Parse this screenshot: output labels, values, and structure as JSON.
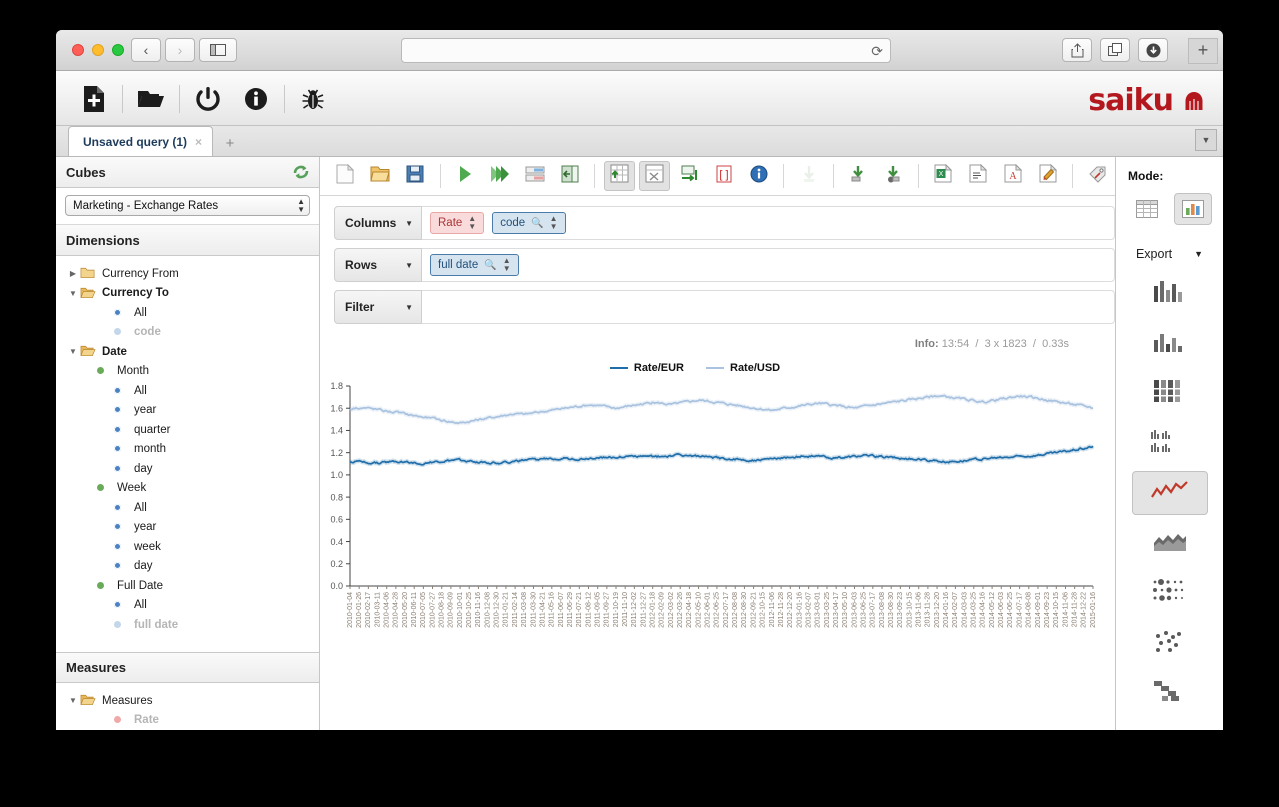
{
  "browser": {
    "url_value": "",
    "url_placeholder": "",
    "back_label": "‹",
    "forward_label": "›",
    "reload_label": "⟳",
    "new_tab_label": "+"
  },
  "app": {
    "logo_text": "saiku",
    "toolbar_icons": [
      "new-document",
      "open-folder",
      "power",
      "info",
      "bug"
    ]
  },
  "tabs": {
    "items": [
      {
        "label": "Unsaved query (1)",
        "close": "×"
      }
    ],
    "add_label": "+",
    "overflow_label": "▼"
  },
  "sidebar": {
    "cubes_title": "Cubes",
    "cube_selected": "Marketing - Exchange Rates",
    "dimensions_title": "Dimensions",
    "measures_title": "Measures",
    "tree": [
      {
        "label": "Currency From",
        "type": "folder",
        "arrow": "▶",
        "indent": 0,
        "style": "plain"
      },
      {
        "label": "Currency To",
        "type": "folder-open",
        "arrow": "▼",
        "indent": 0,
        "style": "bold"
      },
      {
        "label": "All",
        "type": "level-blue",
        "indent": 2,
        "style": "plain"
      },
      {
        "label": "code",
        "type": "level-pale",
        "indent": 2,
        "style": "grey"
      },
      {
        "label": "Date",
        "type": "folder-open",
        "arrow": "▼",
        "indent": 0,
        "style": "bold"
      },
      {
        "label": "Month",
        "type": "hier-green",
        "indent": 1,
        "style": "plain"
      },
      {
        "label": "All",
        "type": "level-blue",
        "indent": 2,
        "style": "plain"
      },
      {
        "label": "year",
        "type": "level-blue",
        "indent": 2,
        "style": "plain"
      },
      {
        "label": "quarter",
        "type": "level-blue",
        "indent": 2,
        "style": "plain"
      },
      {
        "label": "month",
        "type": "level-blue",
        "indent": 2,
        "style": "plain"
      },
      {
        "label": "day",
        "type": "level-blue",
        "indent": 2,
        "style": "plain"
      },
      {
        "label": "Week",
        "type": "hier-green",
        "indent": 1,
        "style": "plain"
      },
      {
        "label": "All",
        "type": "level-blue",
        "indent": 2,
        "style": "plain"
      },
      {
        "label": "year",
        "type": "level-blue",
        "indent": 2,
        "style": "plain"
      },
      {
        "label": "week",
        "type": "level-blue",
        "indent": 2,
        "style": "plain"
      },
      {
        "label": "day",
        "type": "level-blue",
        "indent": 2,
        "style": "plain"
      },
      {
        "label": "Full Date",
        "type": "hier-green",
        "indent": 1,
        "style": "plain"
      },
      {
        "label": "All",
        "type": "level-blue",
        "indent": 2,
        "style": "plain"
      },
      {
        "label": "full date",
        "type": "level-pale",
        "indent": 2,
        "style": "grey"
      }
    ],
    "measures_tree": [
      {
        "label": "Measures",
        "type": "folder-open",
        "arrow": "▼",
        "indent": 0,
        "style": "plain"
      },
      {
        "label": "Rate",
        "type": "measure-pink",
        "indent": 2,
        "style": "grey"
      }
    ]
  },
  "dropzones": {
    "columns": {
      "label": "Columns",
      "chips": [
        {
          "text": "Rate",
          "kind": "measure",
          "has_search": false
        },
        {
          "text": "code",
          "kind": "dim",
          "has_search": true
        }
      ]
    },
    "rows": {
      "label": "Rows",
      "chips": [
        {
          "text": "full date",
          "kind": "dim",
          "has_search": true
        }
      ]
    },
    "filter": {
      "label": "Filter",
      "chips": []
    }
  },
  "info": {
    "prefix": "Info:",
    "time": "13:54",
    "size": "3 x 1823",
    "duration": "0.33s",
    "separator": "/"
  },
  "mode_panel": {
    "title": "Mode:",
    "table_mode_label": "table-mode",
    "chart_mode_label": "chart-mode",
    "export_label": "Export",
    "export_caret": "▼",
    "chart_types": [
      "bar-chart",
      "stacked-bar-chart",
      "stacked-percent-bar-chart",
      "multiple-bar-chart",
      "line-chart",
      "area-chart",
      "dot-matrix-chart",
      "scatter-chart",
      "waterfall-chart",
      "pie-chart"
    ],
    "selected_chart_type": "line-chart"
  },
  "chart_data": {
    "type": "line",
    "title": "",
    "xlabel": "",
    "ylabel": "",
    "ylim": [
      0.0,
      1.8
    ],
    "yticks": [
      0.0,
      0.2,
      0.4,
      0.6,
      0.8,
      1.0,
      1.2,
      1.4,
      1.6,
      1.8
    ],
    "grid": false,
    "legend_position": "top-center",
    "colors": {
      "Rate/EUR": "#1f6eaa",
      "Rate/USD": "#a8c2df"
    },
    "xtick_start": "2010-01-04",
    "xtick_end": "2015-01-17",
    "xtick_step_days": 22,
    "xticks": [
      "2010-01-04",
      "2010-01-26",
      "2010-02-17",
      "2010-03-11",
      "2010-04-06",
      "2010-04-28",
      "2010-05-20",
      "2010-06-11",
      "2010-07-05",
      "2010-07-27",
      "2010-08-18",
      "2010-09-09",
      "2010-10-01",
      "2010-10-25",
      "2010-11-16",
      "2010-12-08",
      "2010-12-30",
      "2011-01-21",
      "2011-02-14",
      "2011-03-08",
      "2011-03-30",
      "2011-04-21",
      "2011-05-16",
      "2011-06-07",
      "2011-06-29",
      "2011-07-21",
      "2011-08-12",
      "2011-09-05",
      "2011-09-27",
      "2011-10-19",
      "2011-11-10",
      "2011-12-02",
      "2011-12-27",
      "2012-01-18",
      "2012-02-09",
      "2012-03-02",
      "2012-03-26",
      "2012-04-18",
      "2012-05-10",
      "2012-06-01",
      "2012-06-25",
      "2012-07-17",
      "2012-08-08",
      "2012-08-30",
      "2012-09-21",
      "2012-10-15",
      "2012-11-06",
      "2012-11-28",
      "2012-12-20",
      "2013-01-16",
      "2013-02-07",
      "2013-03-01",
      "2013-03-25",
      "2013-04-17",
      "2013-05-10",
      "2013-06-03",
      "2013-06-25",
      "2013-07-17",
      "2013-08-08",
      "2013-08-30",
      "2013-09-23",
      "2013-10-15",
      "2013-11-06",
      "2013-11-28",
      "2013-12-20",
      "2014-01-16",
      "2014-02-07",
      "2014-03-03",
      "2014-03-25",
      "2014-04-16",
      "2014-05-12",
      "2014-06-03",
      "2014-06-25",
      "2014-07-17",
      "2014-08-08",
      "2014-09-01",
      "2014-09-23",
      "2014-10-15",
      "2014-11-06",
      "2014-11-28",
      "2014-12-22",
      "2015-01-16"
    ],
    "series": [
      {
        "name": "Rate/EUR",
        "color": "#1f6eaa",
        "values": [
          1.117,
          1.12,
          1.112,
          1.108,
          1.115,
          1.122,
          1.118,
          1.11,
          1.105,
          1.112,
          1.12,
          1.126,
          1.13,
          1.124,
          1.118,
          1.112,
          1.108,
          1.114,
          1.122,
          1.128,
          1.135,
          1.142,
          1.148,
          1.152,
          1.147,
          1.14,
          1.148,
          1.156,
          1.16,
          1.158,
          1.164,
          1.17,
          1.166,
          1.16,
          1.168,
          1.174,
          1.178,
          1.172,
          1.166,
          1.158,
          1.152,
          1.146,
          1.14,
          1.134,
          1.128,
          1.134,
          1.142,
          1.15,
          1.158,
          1.164,
          1.17,
          1.166,
          1.158,
          1.152,
          1.16,
          1.168,
          1.174,
          1.17,
          1.164,
          1.158,
          1.15,
          1.144,
          1.138,
          1.132,
          1.126,
          1.12,
          1.124,
          1.13,
          1.136,
          1.142,
          1.148,
          1.154,
          1.16,
          1.166,
          1.172,
          1.18,
          1.19,
          1.2,
          1.212,
          1.226,
          1.24,
          1.256
        ]
      },
      {
        "name": "Rate/USD",
        "color": "#a8c2df",
        "values": [
          1.595,
          1.608,
          1.6,
          1.588,
          1.574,
          1.562,
          1.548,
          1.534,
          1.52,
          1.506,
          1.492,
          1.478,
          1.466,
          1.48,
          1.496,
          1.51,
          1.524,
          1.538,
          1.55,
          1.544,
          1.556,
          1.57,
          1.582,
          1.594,
          1.606,
          1.618,
          1.63,
          1.624,
          1.612,
          1.6,
          1.614,
          1.628,
          1.64,
          1.652,
          1.644,
          1.632,
          1.646,
          1.66,
          1.672,
          1.664,
          1.652,
          1.64,
          1.628,
          1.616,
          1.604,
          1.592,
          1.58,
          1.594,
          1.608,
          1.62,
          1.632,
          1.644,
          1.636,
          1.624,
          1.612,
          1.6,
          1.614,
          1.628,
          1.64,
          1.652,
          1.664,
          1.676,
          1.688,
          1.7,
          1.712,
          1.704,
          1.692,
          1.68,
          1.668,
          1.656,
          1.668,
          1.682,
          1.696,
          1.71,
          1.7,
          1.688,
          1.674,
          1.66,
          1.646,
          1.632,
          1.618,
          1.604
        ]
      }
    ]
  }
}
